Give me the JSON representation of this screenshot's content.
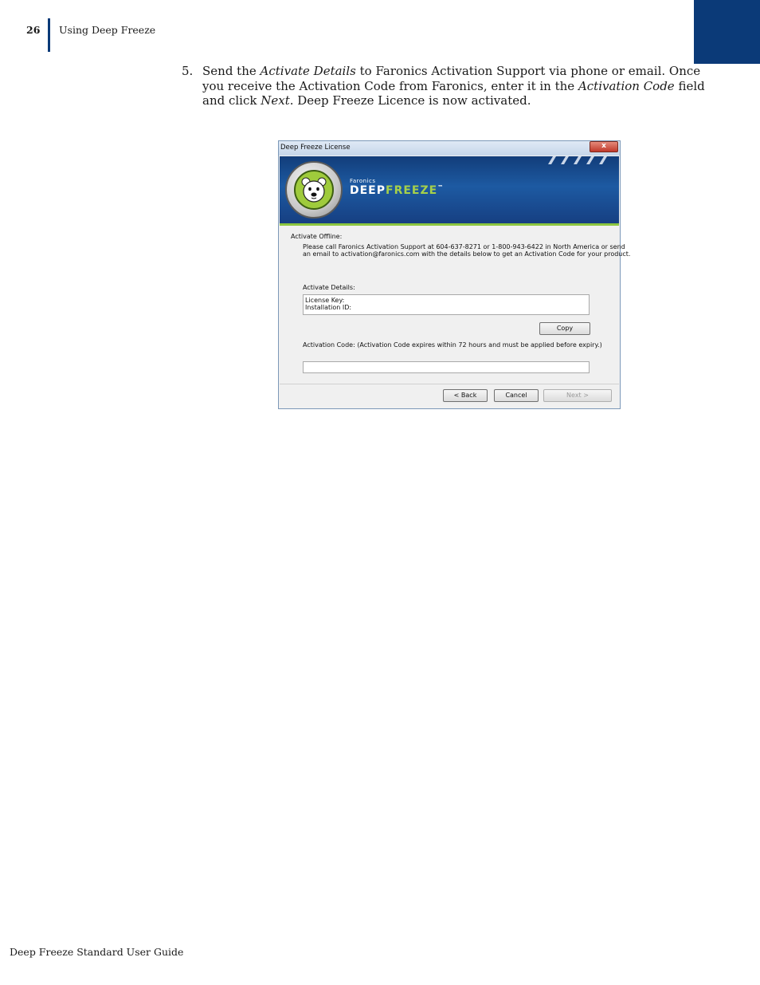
{
  "header": {
    "page_number": "26",
    "section_title": "Using Deep Freeze"
  },
  "step": {
    "number": "5.",
    "text_1": "Send the ",
    "em_1": "Activate Details",
    "text_2": " to Faronics Activation Support via phone or email. Once you receive the Activation Code from Faronics, enter it in the ",
    "em_2": "Activation Code",
    "text_3": " field and click ",
    "em_3": "Next",
    "text_4": ". Deep Freeze Licence is now activated."
  },
  "dialog": {
    "title": "Deep Freeze License",
    "close_glyph": "x",
    "brand_small": "Faronics",
    "brand_deep": "DEEP",
    "brand_freeze": "FREEZE",
    "brand_tm": "™",
    "section_label": "Activate Offline:",
    "instructions_line1": "Please call Faronics Activation Support at 604-637-8271 or 1-800-943-6422 in North America or send",
    "instructions_line2": "an email to activation@faronics.com with the details below to get an Activation Code for your product.",
    "details_label": "Activate Details:",
    "details_line1": "License Key:",
    "details_line2": "Installation ID:",
    "copy_button": "Copy",
    "activation_code_label": "Activation Code: (Activation Code expires within 72 hours and must be applied before expiry.)",
    "activation_code_value": "",
    "back_button": "< Back",
    "cancel_button": "Cancel",
    "next_button": "Next >"
  },
  "footer": {
    "text": "Deep Freeze Standard User Guide"
  },
  "colors": {
    "accent_navy": "#0b3a78",
    "brand_green": "#8cc63f"
  }
}
